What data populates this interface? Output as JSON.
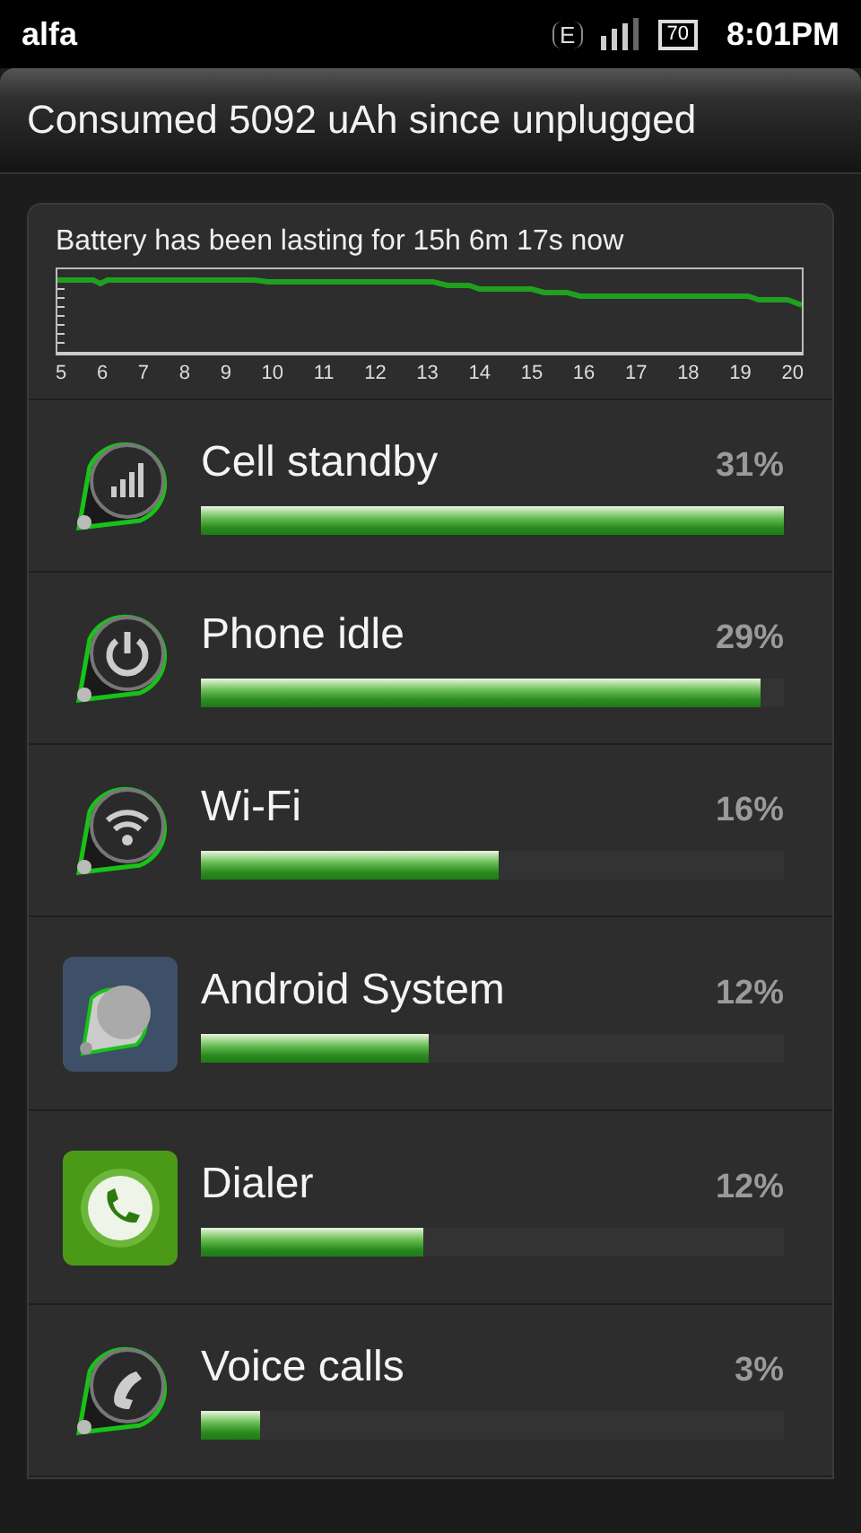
{
  "status_bar": {
    "carrier": "alfa",
    "network": "E",
    "battery": "70",
    "time": "8:01PM"
  },
  "header": {
    "title": "Consumed 5092 uAh since unplugged"
  },
  "history": {
    "caption": "Battery has been lasting for 15h 6m 17s now",
    "axis_labels": [
      "5",
      "6",
      "7",
      "8",
      "9",
      "10",
      "11",
      "12",
      "13",
      "14",
      "15",
      "16",
      "17",
      "18",
      "19",
      "20"
    ]
  },
  "usage": [
    {
      "kind": "signal",
      "name": "Cell standby",
      "percent": "31%",
      "level": 1.0
    },
    {
      "kind": "power",
      "name": "Phone idle",
      "percent": "29%",
      "level": 0.96
    },
    {
      "kind": "wifi",
      "name": "Wi-Fi",
      "percent": "16%",
      "level": 0.51
    },
    {
      "kind": "system",
      "name": "Android System",
      "percent": "12%",
      "level": 0.39
    },
    {
      "kind": "dialer",
      "name": "Dialer",
      "percent": "12%",
      "level": 0.38
    },
    {
      "kind": "call",
      "name": "Voice calls",
      "percent": "3%",
      "level": 0.1
    }
  ]
}
